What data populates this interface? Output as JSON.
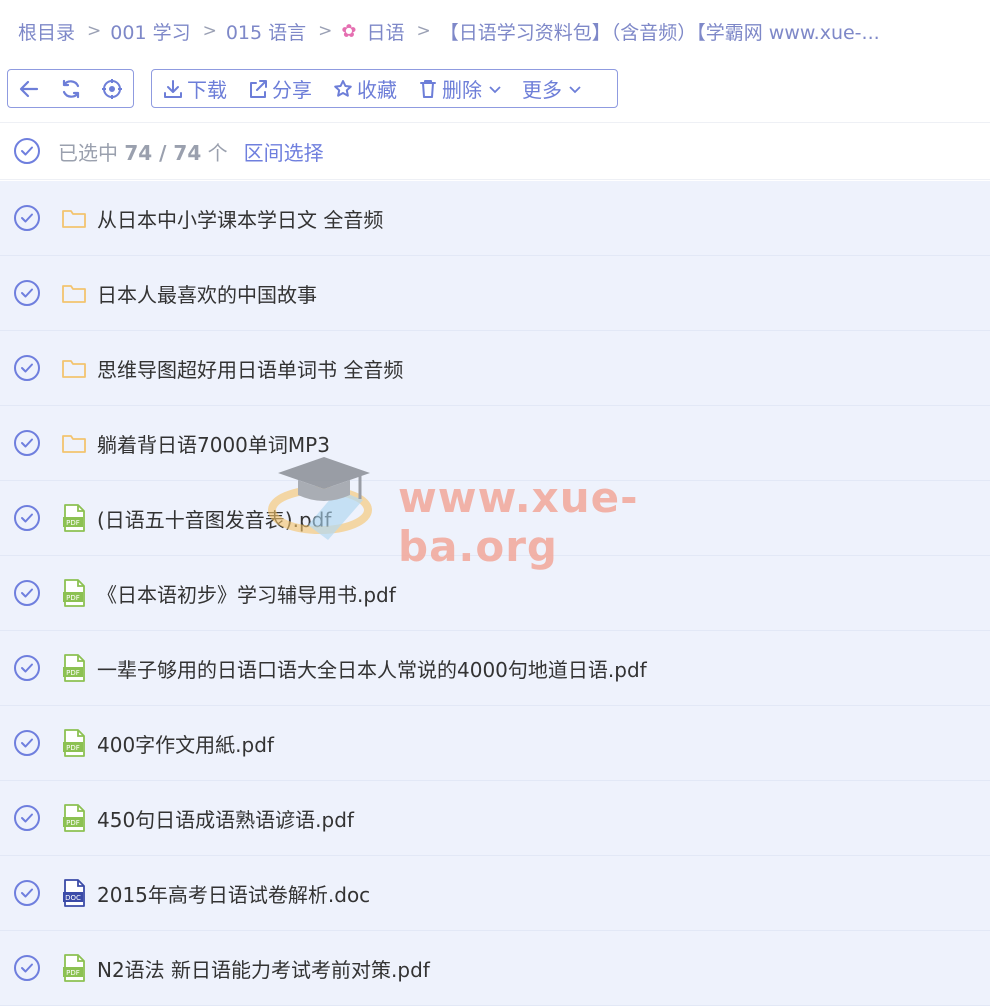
{
  "breadcrumb": {
    "items": [
      "根目录",
      "001 学习",
      "015 语言",
      "日语",
      "【日语学习资料包】（含音频）【学霸网 www.xue-..."
    ],
    "separator": ">"
  },
  "toolbar": {
    "download": "下载",
    "share": "分享",
    "favorite": "收藏",
    "delete": "删除",
    "more": "更多"
  },
  "selection": {
    "prefix": "已选中",
    "count": "74 / 74",
    "suffix": "个",
    "range_select": "区间选择"
  },
  "files": [
    {
      "name": "从日本中小学课本学日文 全音频",
      "type": "folder"
    },
    {
      "name": "日本人最喜欢的中国故事",
      "type": "folder"
    },
    {
      "name": "思维导图超好用日语单词书 全音频",
      "type": "folder"
    },
    {
      "name": "躺着背日语7000单词MP3",
      "type": "folder"
    },
    {
      "name": "(日语五十音图发音表).pdf",
      "type": "pdf"
    },
    {
      "name": "《日本语初步》学习辅导用书.pdf",
      "type": "pdf"
    },
    {
      "name": "一辈子够用的日语口语大全日本人常说的4000句地道日语.pdf",
      "type": "pdf"
    },
    {
      "name": "400字作文用紙.pdf",
      "type": "pdf"
    },
    {
      "name": "450句日语成语熟语谚语.pdf",
      "type": "pdf"
    },
    {
      "name": "2015年高考日语试卷解析.doc",
      "type": "doc"
    },
    {
      "name": "N2语法  新日语能力考试考前对策.pdf",
      "type": "pdf"
    }
  ],
  "icon_labels": {
    "pdf": "PDF",
    "doc": "DOC"
  },
  "watermark": {
    "text": "www.xue-ba.org"
  },
  "colors": {
    "accent": "#6f7fde",
    "folder": "#f3c46f",
    "pdf": "#8cc152",
    "doc": "#3b4ba8",
    "row_bg": "#eef2fc"
  }
}
